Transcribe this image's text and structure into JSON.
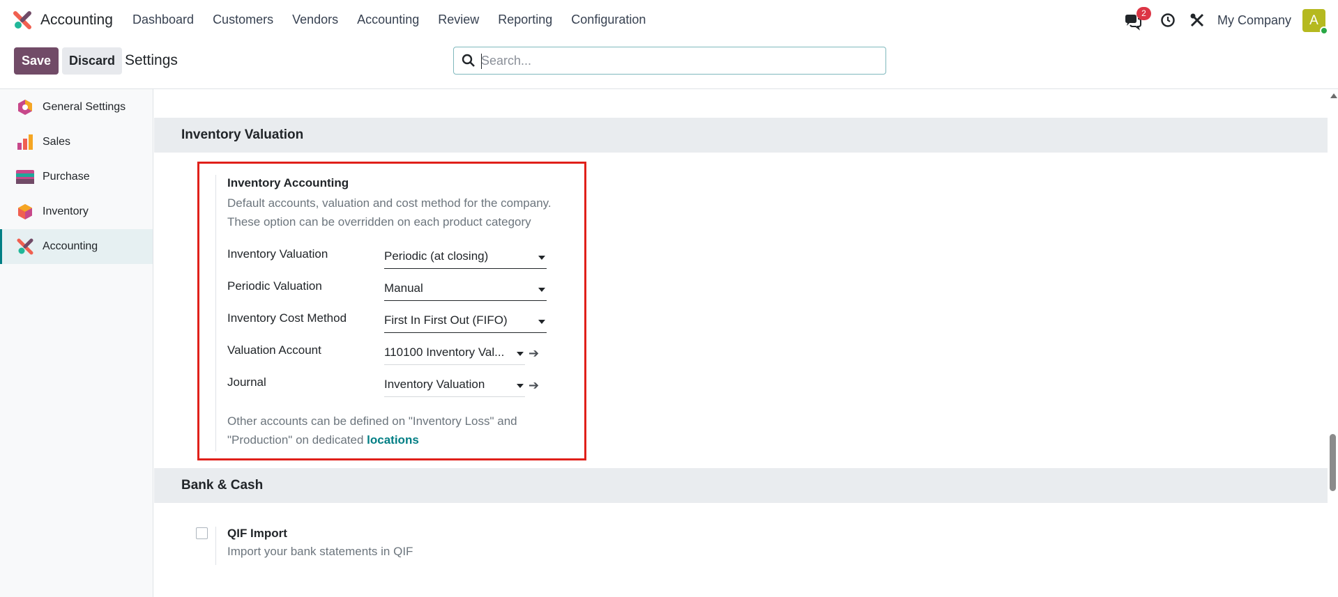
{
  "app": {
    "name": "Accounting"
  },
  "menu": [
    "Dashboard",
    "Customers",
    "Vendors",
    "Accounting",
    "Review",
    "Reporting",
    "Configuration"
  ],
  "systray": {
    "messages_count": "2",
    "company": "My Company",
    "avatar_letter": "A"
  },
  "control": {
    "save": "Save",
    "discard": "Discard",
    "title": "Settings"
  },
  "search": {
    "placeholder": "Search...",
    "value": ""
  },
  "sidebar": {
    "items": [
      {
        "label": "General Settings",
        "icon": "general-settings-icon"
      },
      {
        "label": "Sales",
        "icon": "sales-icon"
      },
      {
        "label": "Purchase",
        "icon": "purchase-icon"
      },
      {
        "label": "Inventory",
        "icon": "inventory-icon"
      },
      {
        "label": "Accounting",
        "icon": "accounting-icon",
        "active": true
      }
    ]
  },
  "sections": {
    "inventory_valuation": {
      "title": "Inventory Valuation",
      "setting": {
        "title": "Inventory Accounting",
        "description_1": "Default accounts, valuation and cost method for the company.",
        "description_2": "These option can be overridden on each product category",
        "fields": {
          "inventory_valuation": {
            "label": "Inventory Valuation",
            "value": "Periodic (at closing)"
          },
          "periodic_valuation": {
            "label": "Periodic Valuation",
            "value": "Manual"
          },
          "cost_method": {
            "label": "Inventory Cost Method",
            "value": "First In First Out (FIFO)"
          },
          "valuation_account": {
            "label": "Valuation Account",
            "value": "110100 Inventory Val..."
          },
          "journal": {
            "label": "Journal",
            "value": "Inventory Valuation"
          }
        },
        "note_1": "Other accounts can be defined on \"Inventory Loss\" and",
        "note_2": "\"Production\" on dedicated ",
        "note_link": "locations"
      }
    },
    "bank_cash": {
      "title": "Bank & Cash",
      "qif": {
        "title": "QIF Import",
        "description": "Import your bank statements in QIF",
        "checked": false
      }
    }
  },
  "colors": {
    "brand": "#714b67",
    "link": "#017e84",
    "highlight_box": "#e0201a",
    "badge": "#dc3545"
  }
}
